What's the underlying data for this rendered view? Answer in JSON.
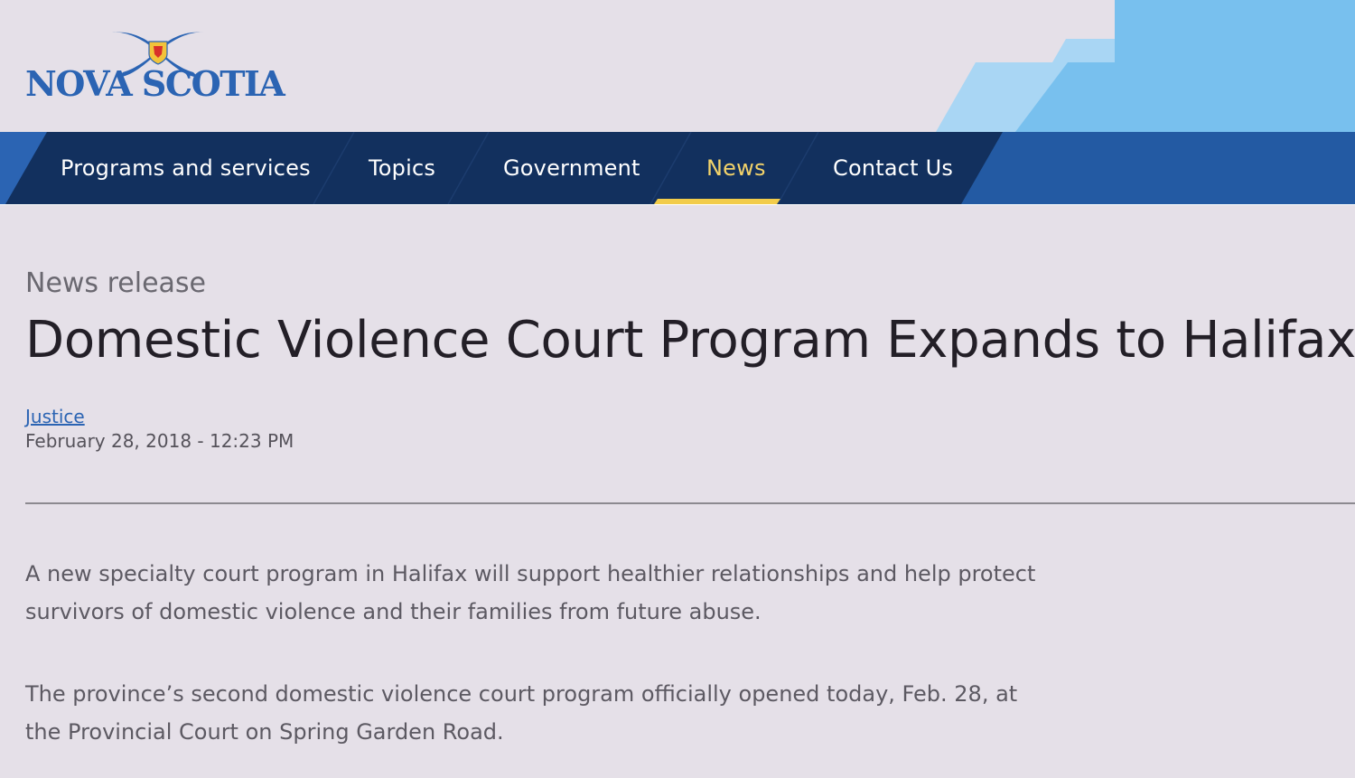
{
  "header": {
    "logo_text": "NOVA SCOTIA",
    "logo_icon": "nova-scotia-saltire-logo"
  },
  "nav": {
    "items": [
      {
        "label": "Programs and services",
        "active": false
      },
      {
        "label": "Topics",
        "active": false
      },
      {
        "label": "Government",
        "active": false
      },
      {
        "label": "News",
        "active": true
      },
      {
        "label": "Contact Us",
        "active": false
      }
    ]
  },
  "article": {
    "eyebrow": "News release",
    "title": "Domestic Violence Court Program Expands to Halifax",
    "department": "Justice",
    "timestamp": "February 28, 2018 - 12:23 PM",
    "paragraphs": [
      "A new specialty court program in Halifax will support healthier relationships and help protect survivors of domestic violence and their families from future abuse.",
      "The province’s second domestic violence court program officially opened today, Feb. 28, at the Provincial Court on Spring Garden Road."
    ]
  },
  "colors": {
    "brand_blue": "#2b64b3",
    "nav_dark": "#12305e",
    "nav_light": "#235aa3",
    "accent_yellow": "#f2cc4a",
    "sky_blue": "#78c0ee",
    "page_bg": "#e5e0e8"
  }
}
